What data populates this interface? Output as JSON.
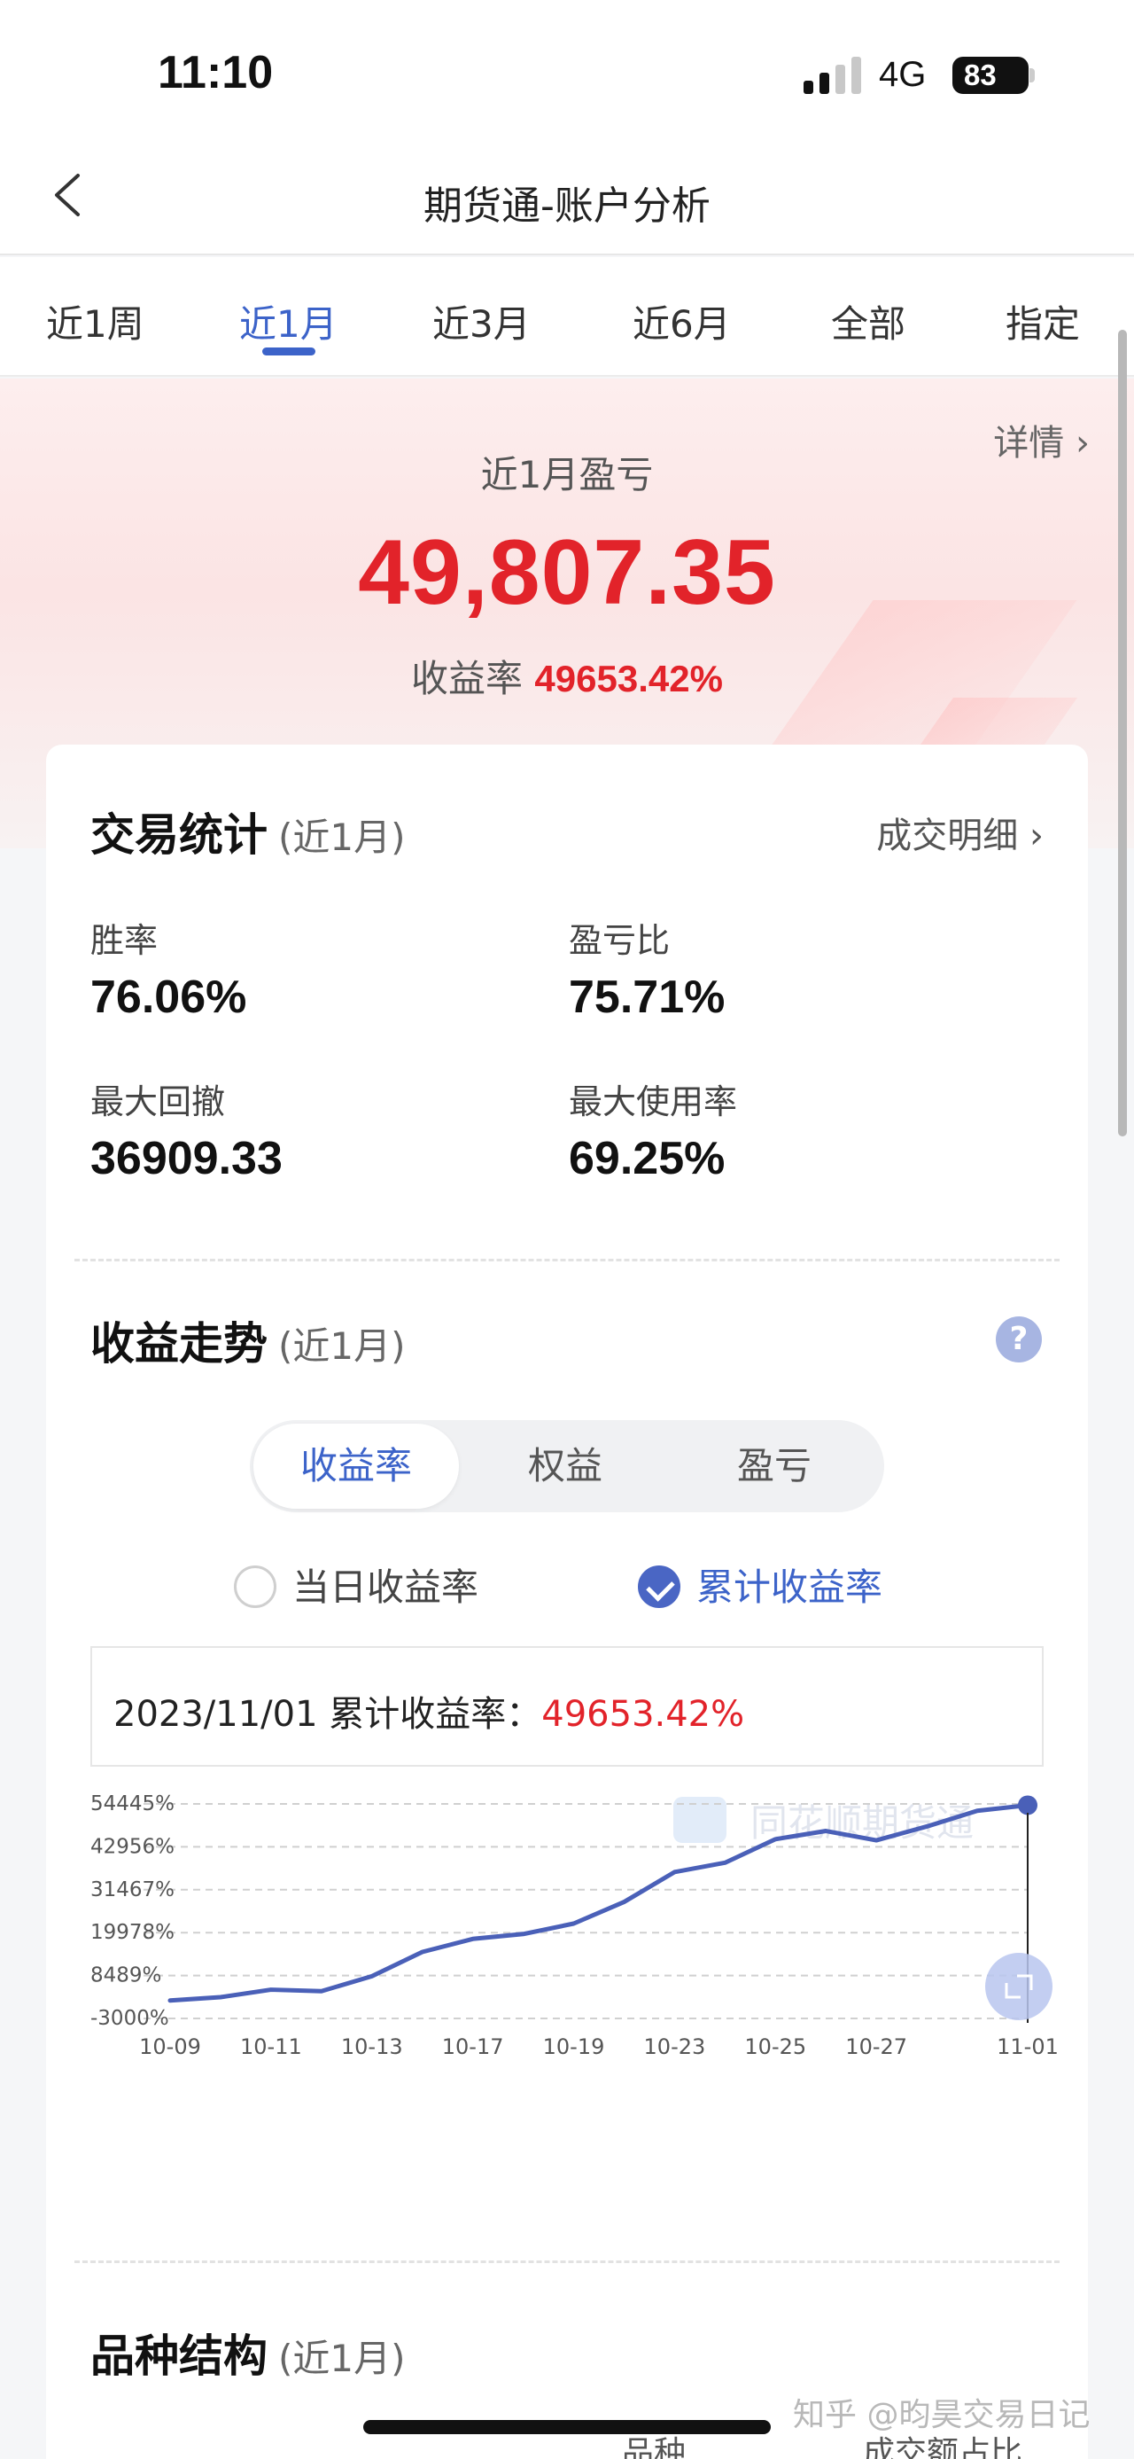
{
  "status_bar": {
    "time": "11:10",
    "network": "4G",
    "battery": "83"
  },
  "header": {
    "title": "期货通-账户分析"
  },
  "tabs": [
    {
      "label": "近1周"
    },
    {
      "label": "近1月",
      "active": true
    },
    {
      "label": "近3月"
    },
    {
      "label": "近6月"
    },
    {
      "label": "全部"
    },
    {
      "label": "指定"
    }
  ],
  "hero": {
    "details_label": "详情 ›",
    "label": "近1月盈亏",
    "value": "49,807.35",
    "rate_label": "收益率",
    "rate_value": "49653.42%"
  },
  "trade_stats": {
    "title": "交易统计",
    "subtitle": "(近1月)",
    "detail_link": "成交明细 ›",
    "items": [
      {
        "label": "胜率",
        "value": "76.06%"
      },
      {
        "label": "盈亏比",
        "value": "75.71%"
      },
      {
        "label": "最大回撤",
        "value": "36909.33"
      },
      {
        "label": "最大使用率",
        "value": "69.25%"
      }
    ]
  },
  "trend": {
    "title": "收益走势",
    "subtitle": "(近1月)",
    "help_icon": "?",
    "segments": [
      {
        "label": "收益率",
        "active": true
      },
      {
        "label": "权益"
      },
      {
        "label": "盈亏"
      }
    ],
    "radios": [
      {
        "label": "当日收益率",
        "checked": false
      },
      {
        "label": "累计收益率",
        "checked": true
      }
    ],
    "info_prefix": "2023/11/01 累计收益率：",
    "info_value": "49653.42%",
    "watermark": "同花顺期货通"
  },
  "chart_data": {
    "type": "line",
    "title": "",
    "xlabel": "",
    "ylabel": "",
    "y_ticks": [
      "54445%",
      "42956%",
      "31467%",
      "19978%",
      "8489%",
      "-3000%"
    ],
    "ylim": [
      -3000,
      54445
    ],
    "x_tick_labels": [
      "10-09",
      "10-11",
      "10-13",
      "10-17",
      "10-19",
      "10-23",
      "10-25",
      "10-27",
      "11-01"
    ],
    "x": [
      "10-09",
      "10-10",
      "10-11",
      "10-12",
      "10-13",
      "10-16",
      "10-17",
      "10-18",
      "10-19",
      "10-20",
      "10-23",
      "10-24",
      "10-25",
      "10-26",
      "10-27",
      "10-30",
      "10-31",
      "11-01"
    ],
    "series": [
      {
        "color": "#4a60b8",
        "values": [
          1800,
          2700,
          4700,
          4300,
          8300,
          14800,
          18300,
          19600,
          22400,
          28200,
          36200,
          38700,
          45000,
          47200,
          44700,
          48400,
          52600,
          54100
        ]
      }
    ],
    "grid": "horizontal-dashed",
    "legend": "none",
    "crosshair_at": "11-01"
  },
  "variety": {
    "title": "品种结构",
    "subtitle": "(近1月)",
    "columns": [
      "品种",
      "成交额占比"
    ]
  },
  "watermark": "知乎 @昀昊交易日记"
}
